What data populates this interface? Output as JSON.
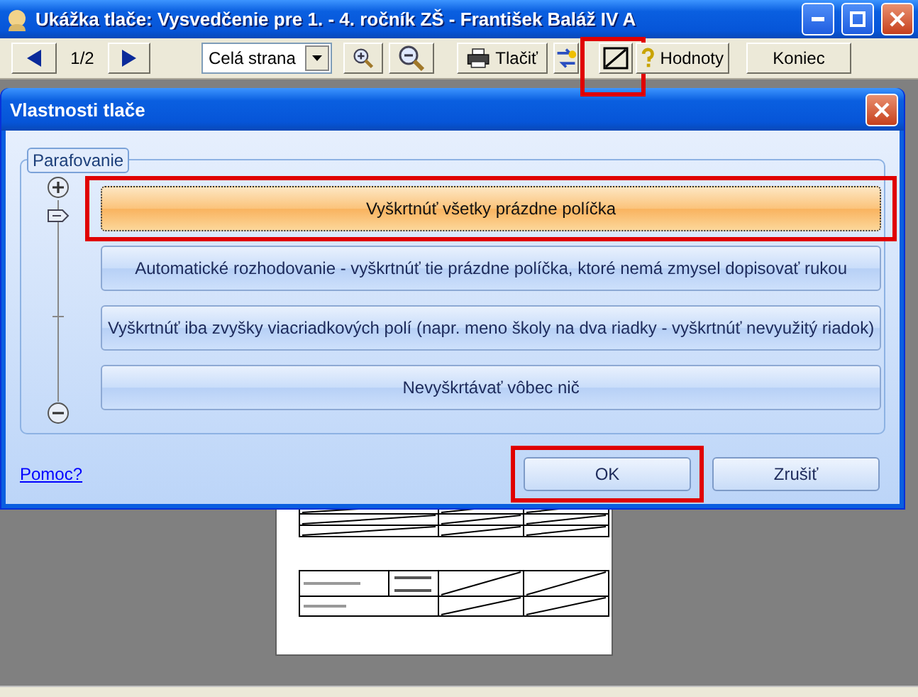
{
  "window": {
    "title": "Ukážka tlače: Vysvedčenie pre 1. - 4. ročník ZŠ - František Baláž IV A"
  },
  "toolbar": [
    {
      "kind": "prev"
    },
    {
      "kind": "text",
      "label": "1/2"
    },
    {
      "kind": "next"
    },
    {
      "kind": "dropdown",
      "value": "Celá strana"
    },
    {
      "kind": "zoom-in"
    },
    {
      "kind": "zoom-out"
    },
    {
      "kind": "print",
      "label": "Tlačiť"
    },
    {
      "kind": "swap"
    },
    {
      "kind": "slash",
      "highlighted": true
    },
    {
      "kind": "values",
      "label": "Hodnoty"
    },
    {
      "kind": "plain",
      "label": "Koniec"
    }
  ],
  "dialog": {
    "title": "Vlastnosti tlače",
    "group": "Parafovanie",
    "options": [
      {
        "label": "Vyškrtnúť všetky prázdne políčka",
        "selected": true,
        "highlighted": true
      },
      {
        "label": "Automatické rozhodovanie - vyškrtnúť tie prázdne políčka, ktoré nemá zmysel dopisovať rukou",
        "selected": false,
        "highlighted": false
      },
      {
        "label": "Vyškrtnúť iba zvyšky viacriadkových polí (napr. meno školy na dva riadky - vyškrtnúť nevyužitý riadok)",
        "selected": false,
        "highlighted": false
      },
      {
        "label": "Nevyškrtávať vôbec nič",
        "selected": false,
        "highlighted": false
      }
    ],
    "help_link": "Pomoc?",
    "buttons": [
      {
        "label": "OK",
        "highlighted": true
      },
      {
        "label": "Zrušiť",
        "highlighted": false
      }
    ]
  }
}
